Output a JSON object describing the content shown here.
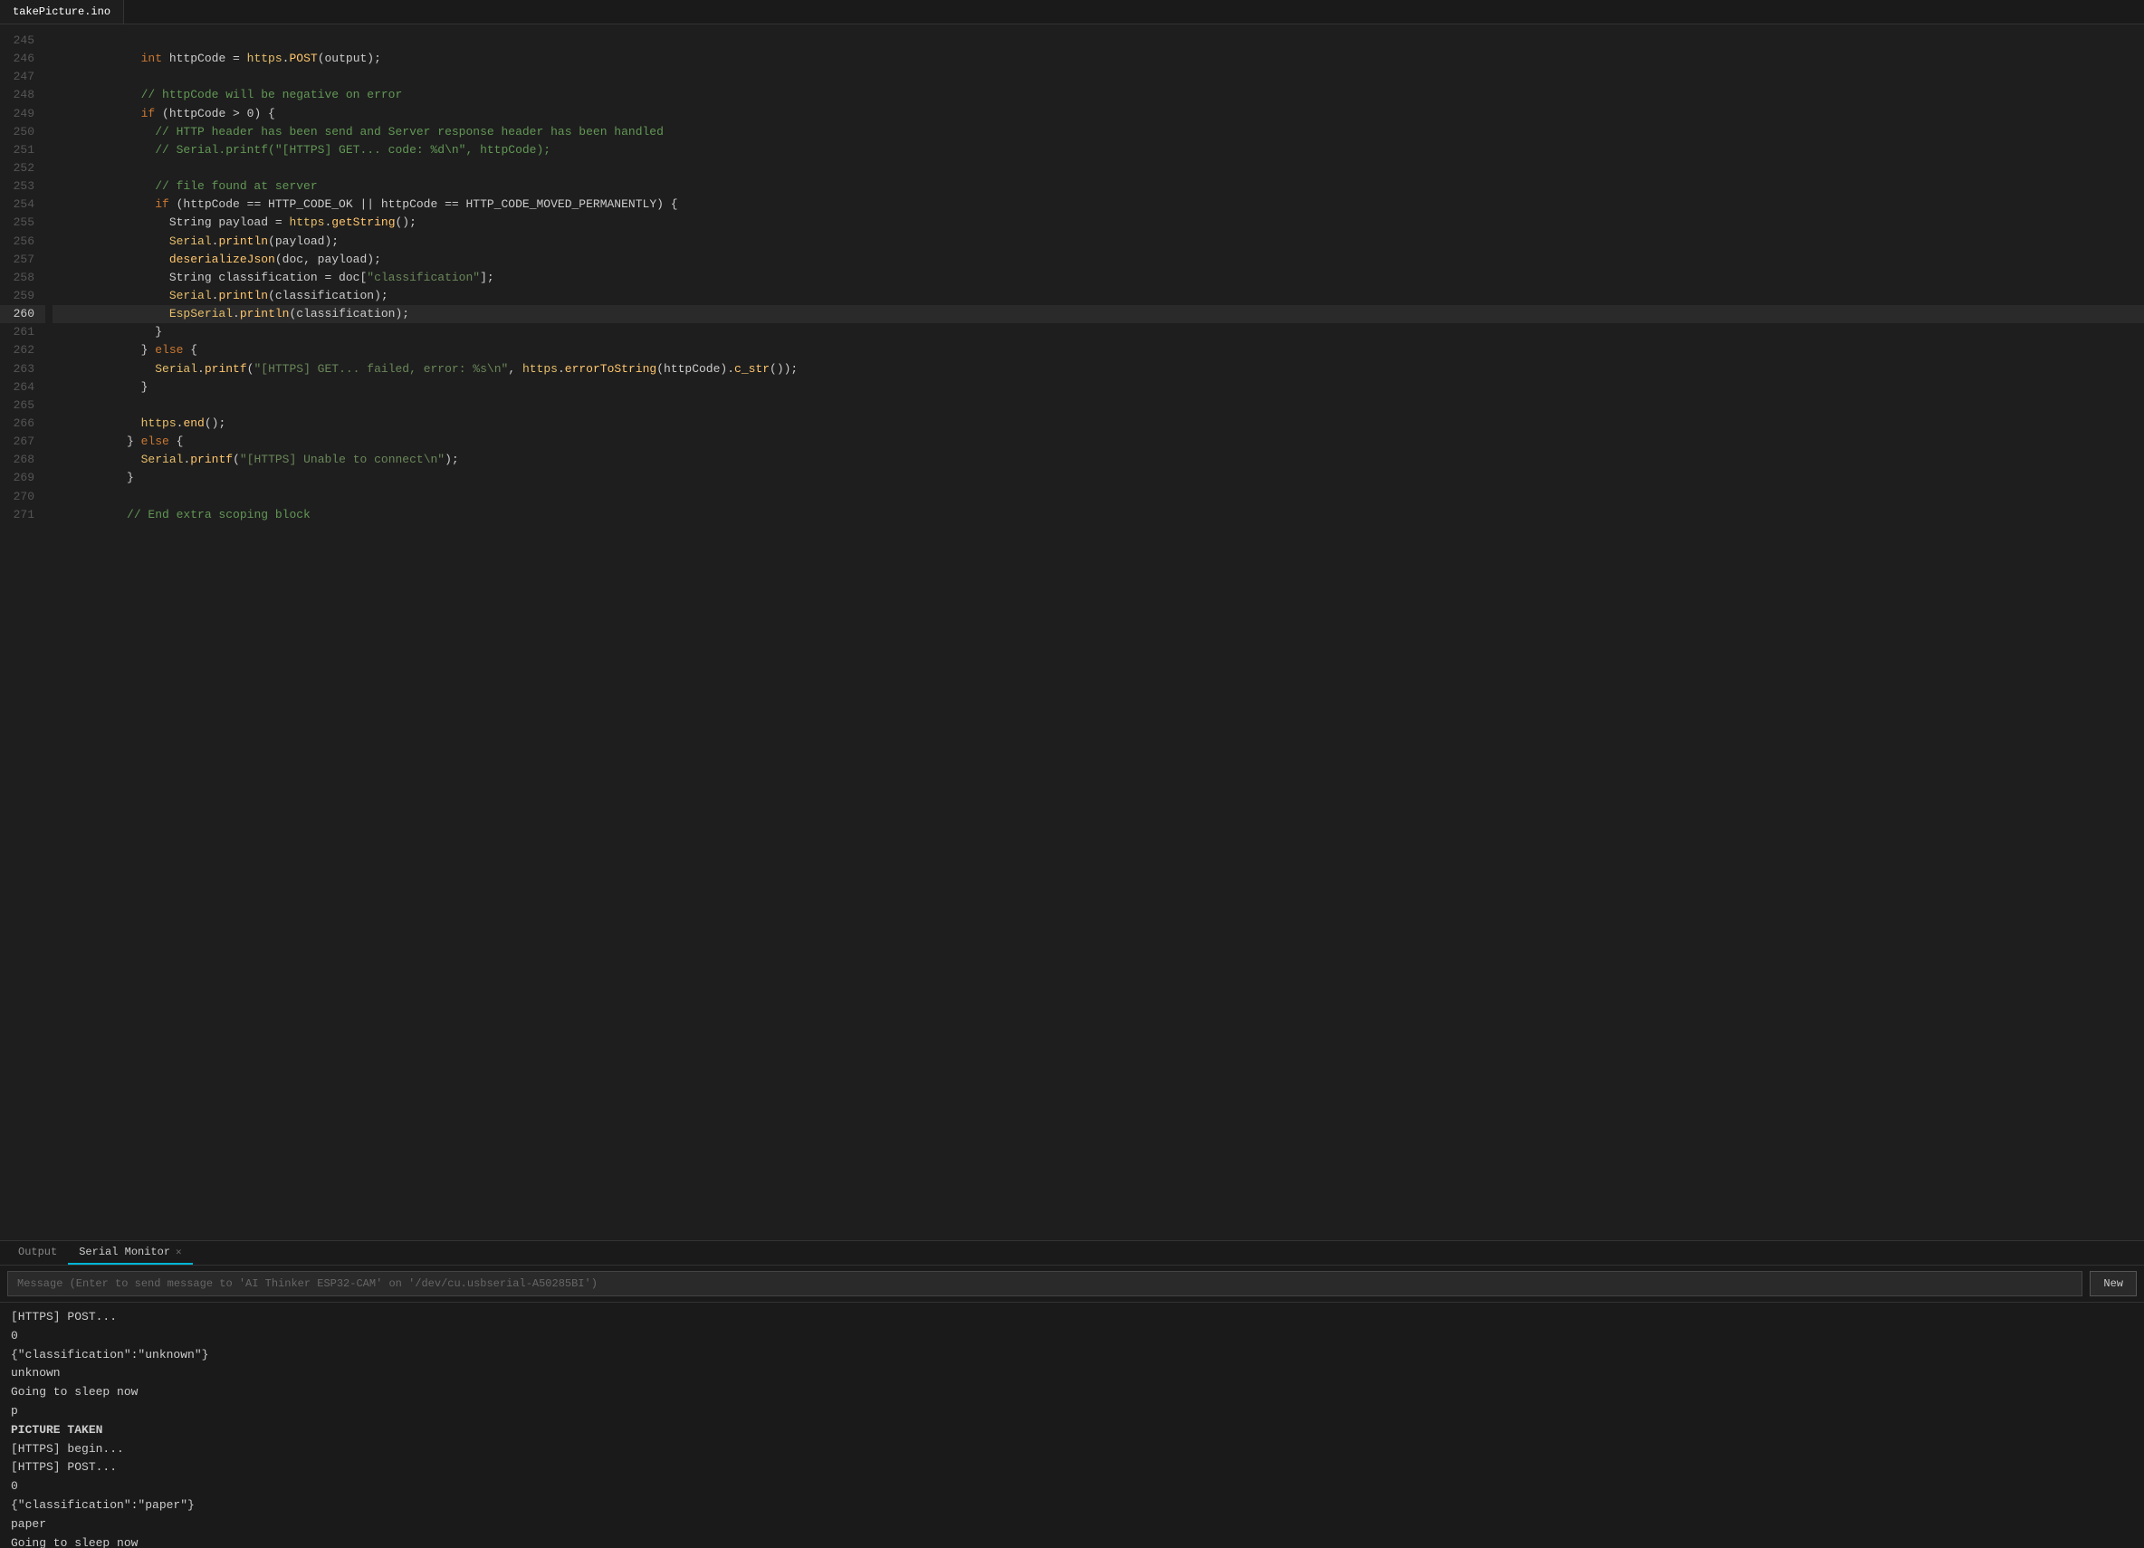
{
  "tab": {
    "filename": "takePicture.ino",
    "active": true
  },
  "code": {
    "lines": [
      {
        "num": 245,
        "content": "",
        "active": false
      },
      {
        "num": 246,
        "content": "            <kw>int</kw> httpCode = <obj>https</obj>.<fn>POST</fn>(output);",
        "active": false
      },
      {
        "num": 247,
        "content": "",
        "active": false
      },
      {
        "num": 248,
        "content": "            <comment>// httpCode will be negative on error</comment>",
        "active": false
      },
      {
        "num": 249,
        "content": "            <kw>if</kw> (httpCode > 0) {",
        "active": false
      },
      {
        "num": 250,
        "content": "              <comment>// HTTP header has been send and Server response header has been handled</comment>",
        "active": false
      },
      {
        "num": 251,
        "content": "              <comment>// Serial.printf(\"[HTTPS] GET... code: %d\\n\", httpCode);</comment>",
        "active": false
      },
      {
        "num": 252,
        "content": "",
        "active": false
      },
      {
        "num": 253,
        "content": "              <comment>// file found at server</comment>",
        "active": false
      },
      {
        "num": 254,
        "content": "              <kw>if</kw> (httpCode == HTTP_CODE_OK || httpCode == HTTP_CODE_MOVED_PERMANENTLY) {",
        "active": false
      },
      {
        "num": 255,
        "content": "                String payload = <obj>https</obj>.<fn>getString</fn>();",
        "active": false
      },
      {
        "num": 256,
        "content": "                <obj>Serial</obj>.<fn>println</fn>(payload);",
        "active": false
      },
      {
        "num": 257,
        "content": "                <fn>deserializeJson</fn>(doc, payload);",
        "active": false
      },
      {
        "num": 258,
        "content": "                String classification = doc[<str>\"classification\"</str>];",
        "active": false
      },
      {
        "num": 259,
        "content": "                <obj>Serial</obj>.<fn>println</fn>(classification);",
        "active": false
      },
      {
        "num": 260,
        "content": "                <obj>EspSerial</obj>.<fn>println</fn>(classification);",
        "active": true
      },
      {
        "num": 261,
        "content": "              }",
        "active": false
      },
      {
        "num": 262,
        "content": "            } <kw>else</kw> {",
        "active": false
      },
      {
        "num": 263,
        "content": "              <obj>Serial</obj>.<fn>printf</fn>(<str>\"[HTTPS] GET... failed, error: %s\\n\"</str>, <obj>https</obj>.<fn>errorToString</fn>(httpCode).<fn>c_str</fn>());",
        "active": false
      },
      {
        "num": 264,
        "content": "            }",
        "active": false
      },
      {
        "num": 265,
        "content": "",
        "active": false
      },
      {
        "num": 266,
        "content": "            <obj>https</obj>.<fn>end</fn>();",
        "active": false
      },
      {
        "num": 267,
        "content": "          } <kw>else</kw> {",
        "active": false
      },
      {
        "num": 268,
        "content": "            <obj>Serial</obj>.<fn>printf</fn>(<str>\"[HTTPS] Unable to connect\\n\"</str>);",
        "active": false
      },
      {
        "num": 269,
        "content": "          }",
        "active": false
      },
      {
        "num": 270,
        "content": "",
        "active": false
      },
      {
        "num": 271,
        "content": "          <comment>// End extra scoping block</comment>",
        "active": false
      }
    ]
  },
  "bottom_panel": {
    "tabs": [
      {
        "label": "Output",
        "active": false,
        "closable": false
      },
      {
        "label": "Serial Monitor",
        "active": true,
        "closable": true
      }
    ],
    "message_input": {
      "placeholder": "Message (Enter to send message to 'AI Thinker ESP32-CAM' on '/dev/cu.usbserial-A50285BI')",
      "value": ""
    },
    "new_button_label": "New",
    "serial_output": [
      {
        "text": "[HTTPS] POST...",
        "bold": false
      },
      {
        "text": "0",
        "bold": false
      },
      {
        "text": "{\"classification\":\"unknown\"}",
        "bold": false
      },
      {
        "text": "unknown",
        "bold": false
      },
      {
        "text": "Going to sleep now",
        "bold": false
      },
      {
        "text": "p",
        "bold": false
      },
      {
        "text": "",
        "bold": false
      },
      {
        "text": "PICTURE TAKEN",
        "bold": true
      },
      {
        "text": "[HTTPS] begin...",
        "bold": false
      },
      {
        "text": "[HTTPS] POST...",
        "bold": false
      },
      {
        "text": "0",
        "bold": false
      },
      {
        "text": "{\"classification\":\"paper\"}",
        "bold": false
      },
      {
        "text": "paper",
        "bold": false
      },
      {
        "text": "Going to sleep now",
        "bold": false
      }
    ]
  }
}
